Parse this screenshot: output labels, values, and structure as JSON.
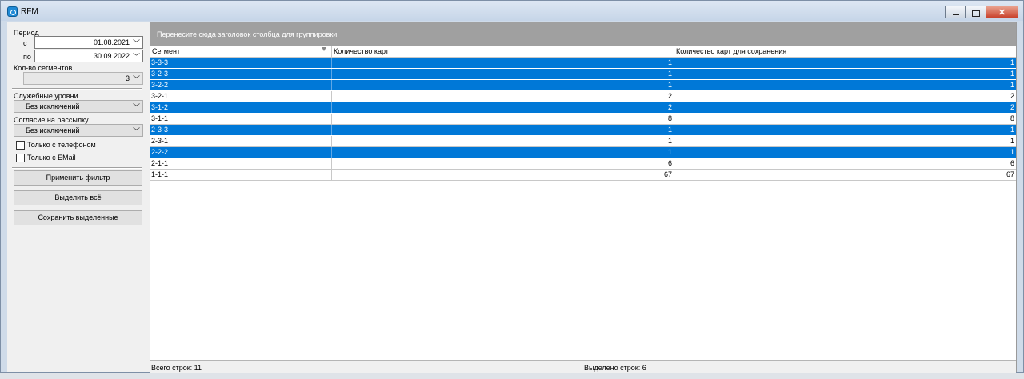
{
  "window": {
    "title": "RFM"
  },
  "filters": {
    "period_label": "Период",
    "from_label": "с",
    "from_date": "01.08.2021",
    "to_label": "по",
    "to_date": "30.09.2022",
    "segments_label": "Кол-во сегментов",
    "segments_value": "3",
    "service_levels_label": "Служебные уровни",
    "service_levels_value": "Без исключений",
    "consent_label": "Согласие на рассылку",
    "consent_value": "Без исключений",
    "only_phone_label": "Только с телефоном",
    "only_email_label": "Только с EMail",
    "apply_button": "Применить фильтр",
    "select_all_button": "Выделить всё",
    "save_selected_button": "Сохранить выделенные"
  },
  "grid": {
    "group_panel_text": "Перенесите сюда заголовок столбца для группировки",
    "columns": [
      "Сегмент",
      "Количество карт",
      "Количество карт для сохранения"
    ],
    "rows": [
      {
        "segment": "3-3-3",
        "cards": "1",
        "cards_to_save": "1",
        "selected": true
      },
      {
        "segment": "3-2-3",
        "cards": "1",
        "cards_to_save": "1",
        "selected": true
      },
      {
        "segment": "3-2-2",
        "cards": "1",
        "cards_to_save": "1",
        "selected": true
      },
      {
        "segment": "3-2-1",
        "cards": "2",
        "cards_to_save": "2",
        "selected": false
      },
      {
        "segment": "3-1-2",
        "cards": "2",
        "cards_to_save": "2",
        "selected": true
      },
      {
        "segment": "3-1-1",
        "cards": "8",
        "cards_to_save": "8",
        "selected": false
      },
      {
        "segment": "2-3-3",
        "cards": "1",
        "cards_to_save": "1",
        "selected": true
      },
      {
        "segment": "2-3-1",
        "cards": "1",
        "cards_to_save": "1",
        "selected": false
      },
      {
        "segment": "2-2-2",
        "cards": "1",
        "cards_to_save": "1",
        "selected": true
      },
      {
        "segment": "2-1-1",
        "cards": "6",
        "cards_to_save": "6",
        "selected": false
      },
      {
        "segment": "1-1-1",
        "cards": "67",
        "cards_to_save": "67",
        "selected": false
      }
    ],
    "total_rows_label": "Всего строк: 11",
    "selected_rows_label": "Выделено строк: 6"
  },
  "colors": {
    "selection": "#0078d7",
    "group_panel": "#a0a0a0"
  }
}
